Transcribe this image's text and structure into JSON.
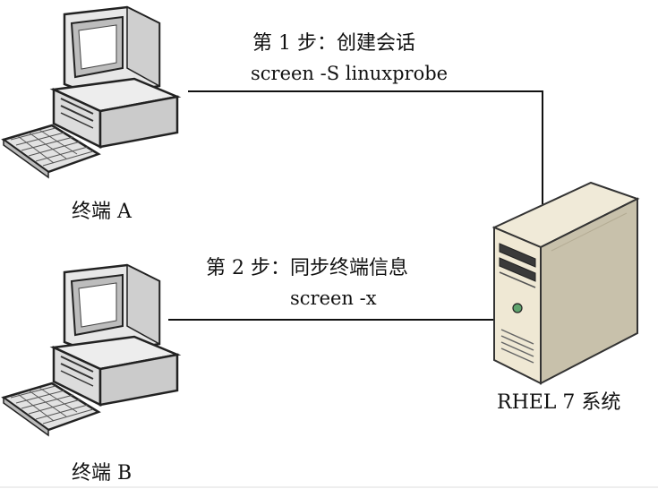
{
  "step1": {
    "title": "第 1 步：创建会话",
    "command": "screen -S linuxprobe"
  },
  "step2": {
    "title": "第 2 步：同步终端信息",
    "command": "screen -x"
  },
  "terminal_a": {
    "label": "终端 A"
  },
  "terminal_b": {
    "label": "终端 B"
  },
  "server": {
    "label": "RHEL 7 系统"
  },
  "icons": {
    "terminal": "desktop-computer-icon",
    "server": "tower-server-icon"
  }
}
